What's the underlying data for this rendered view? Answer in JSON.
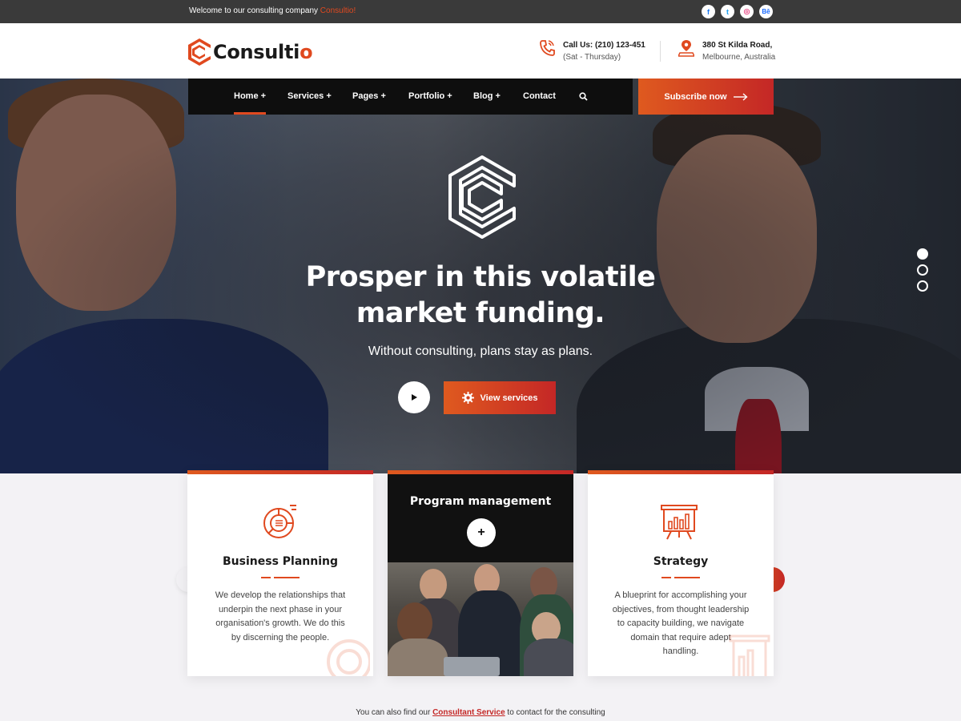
{
  "topbar": {
    "welcome_text": "Welcome to our consulting company ",
    "brand": "Consultio!",
    "socials": [
      {
        "icon": "facebook-icon",
        "glyph": "f",
        "color": "#1877f2"
      },
      {
        "icon": "twitter-icon",
        "glyph": "t",
        "color": "#1da1f2"
      },
      {
        "icon": "dribbble-icon",
        "glyph": "◎",
        "color": "#ea4c89"
      },
      {
        "icon": "behance-icon",
        "glyph": "Bē",
        "color": "#1769ff"
      }
    ]
  },
  "header": {
    "logo_text_main": "Consulti",
    "logo_text_accent": "o",
    "call_label": "Call Us: (210) 123-451",
    "call_hours": "(Sat - Thursday)",
    "address_line1": "380 St Kilda Road,",
    "address_line2": "Melbourne, Australia"
  },
  "nav": {
    "items": [
      {
        "label": "Home +",
        "active": true
      },
      {
        "label": "Services +"
      },
      {
        "label": "Pages +"
      },
      {
        "label": "Portfolio +"
      },
      {
        "label": "Blog +"
      },
      {
        "label": "Contact"
      }
    ],
    "subscribe_label": "Subscribe now"
  },
  "hero": {
    "title_line1": "Prosper in this volatile",
    "title_line2": "market funding.",
    "subtitle": "Without consulting, plans stay as plans.",
    "view_services_label": "View services",
    "slide_count": 3,
    "active_slide": 1
  },
  "cards": [
    {
      "title": "Business Planning",
      "description": "We develop the relationships that underpin the next phase in your organisation's growth. We do this by discerning the people."
    },
    {
      "title": "Program management"
    },
    {
      "title": "Strategy",
      "description": "A blueprint for accomplishing your objectives, from thought leadership to capacity building, we navigate domain that require adept handling."
    }
  ],
  "footer_note": {
    "before": "You can also find our ",
    "link": "Consultant Service",
    "after": " to contact for the consulting"
  },
  "colors": {
    "accent": "#e0491f",
    "accent_dark": "#c42726",
    "topbar_bg": "#3a3a3a",
    "nav_bg": "#0e0e0e"
  }
}
